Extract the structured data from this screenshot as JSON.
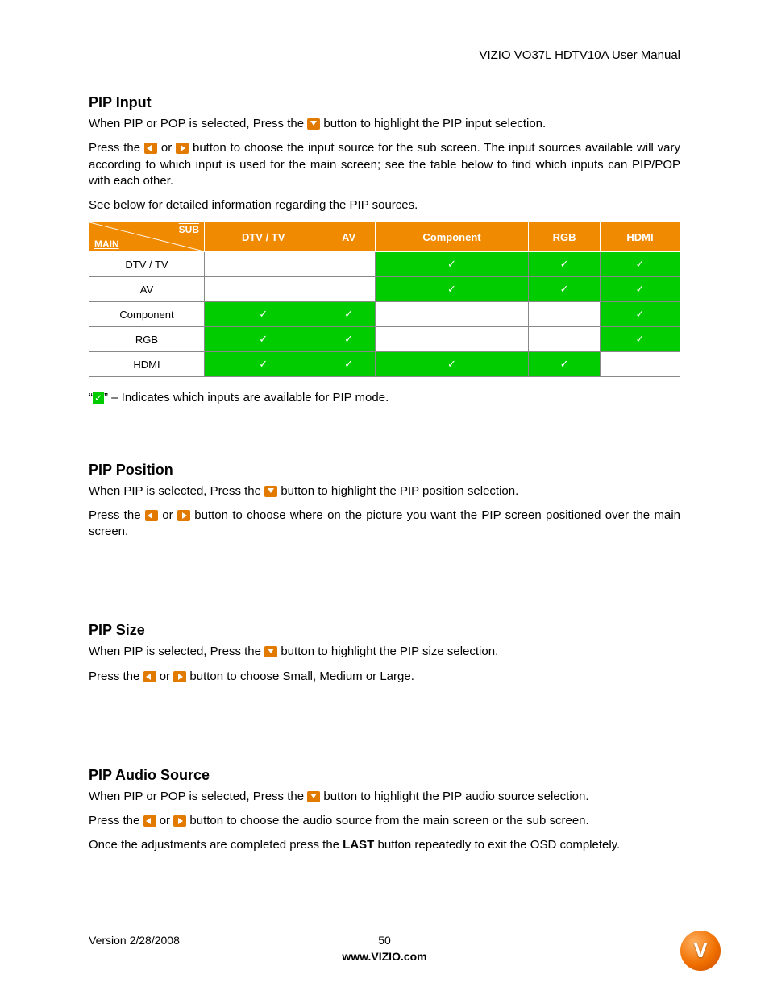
{
  "header": {
    "title": "VIZIO VO37L HDTV10A User Manual"
  },
  "sections": {
    "pipInput": {
      "heading": "PIP Input",
      "line1a": "When PIP or POP is selected, Press the ",
      "line1b": " button to highlight the PIP input selection.",
      "line2a": "Press the ",
      "line2mid": " or ",
      "line2b": " button to choose the input source for the sub screen. The input sources available will vary according to which input is used for the main screen; see the table below to find which inputs can PIP/POP with each other.",
      "line3": "See below for detailed information regarding the PIP sources."
    },
    "pipPosition": {
      "heading": "PIP Position",
      "line1a": "When PIP is selected, Press the ",
      "line1b": " button to highlight the PIP position selection.",
      "line2a": "Press the ",
      "line2mid": " or ",
      "line2b": " button to choose where on the picture you want the PIP screen positioned over the main screen."
    },
    "pipSize": {
      "heading": "PIP Size",
      "line1a": "When PIP is selected, Press the ",
      "line1b": " button to highlight the PIP size selection.",
      "line2a": "Press the ",
      "line2mid": " or ",
      "line2b": " button to choose Small, Medium or Large."
    },
    "pipAudio": {
      "heading": "PIP Audio Source",
      "line1a": "When PIP or POP is selected, Press the ",
      "line1b": " button to highlight the PIP audio source selection.",
      "line2a": "Press the ",
      "line2mid": " or ",
      "line2b": " button to choose the audio source from the main screen or the sub screen.",
      "line3a": "Once the adjustments are completed press the ",
      "lastBtn": "LAST",
      "line3b": " button repeatedly to exit the OSD completely."
    }
  },
  "table": {
    "cornerSub": "SUB",
    "cornerMain": "MAIN",
    "columns": [
      "DTV / TV",
      "AV",
      "Component",
      "RGB",
      "HDMI"
    ],
    "rows": [
      {
        "label": "DTV / TV",
        "cells": [
          false,
          false,
          true,
          true,
          true
        ]
      },
      {
        "label": "AV",
        "cells": [
          false,
          false,
          true,
          true,
          true
        ]
      },
      {
        "label": "Component",
        "cells": [
          true,
          true,
          false,
          false,
          true
        ]
      },
      {
        "label": "RGB",
        "cells": [
          true,
          true,
          false,
          false,
          true
        ]
      },
      {
        "label": "HDMI",
        "cells": [
          true,
          true,
          true,
          true,
          false
        ]
      }
    ]
  },
  "legend": {
    "prefix": "“",
    "suffix": "” – Indicates which inputs are available for PIP mode."
  },
  "footer": {
    "version": "Version 2/28/2008",
    "page": "50",
    "url": "www.VIZIO.com"
  },
  "logoLetter": "V"
}
